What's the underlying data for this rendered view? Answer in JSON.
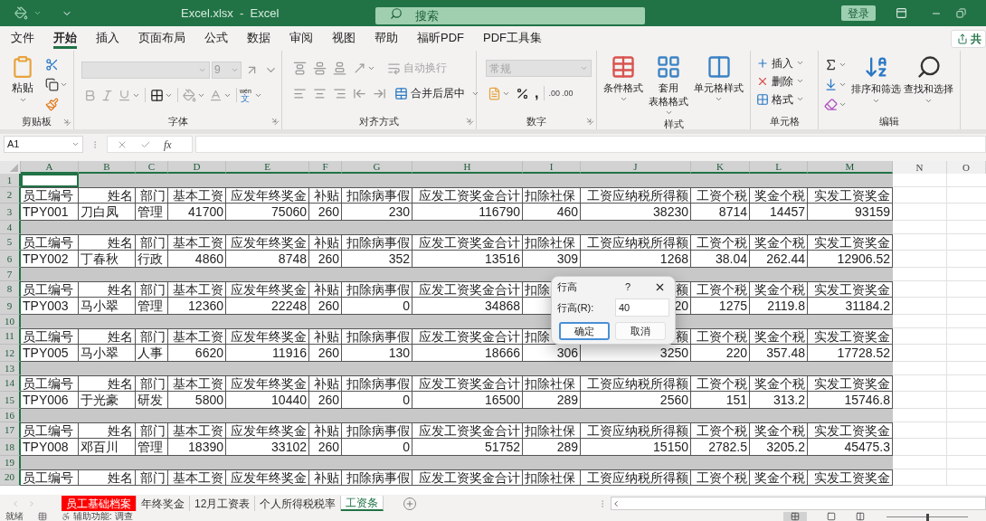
{
  "title_bar": {
    "title": "Excel.xlsx  -  Excel",
    "search": {
      "placeholder": "搜索"
    },
    "sign_in": "登录"
  },
  "menu_tabs": [
    {
      "label": "文件",
      "selected": false
    },
    {
      "label": "开始",
      "selected": true
    },
    {
      "label": "插入",
      "selected": false
    },
    {
      "label": "页面布局",
      "selected": false
    },
    {
      "label": "公式",
      "selected": false
    },
    {
      "label": "数据",
      "selected": false
    },
    {
      "label": "审阅",
      "selected": false
    },
    {
      "label": "视图",
      "selected": false
    },
    {
      "label": "帮助",
      "selected": false
    },
    {
      "label": "福昕PDF",
      "selected": false
    },
    {
      "label": "PDF工具集",
      "selected": false
    }
  ],
  "share": "共",
  "ribbon": {
    "clipboard": {
      "label": "剪贴板",
      "paste": "粘贴"
    },
    "font": {
      "label": "字体",
      "size": "9",
      "phonetic_top": "wén",
      "phonetic_bottom": "文"
    },
    "alignment": {
      "label": "对齐方式",
      "wrap": {
        "label": "自动换行",
        "disabled": true
      },
      "merge": "合并后居中"
    },
    "number": {
      "label": "数字",
      "format": {
        "value": "常规",
        "disabled": true
      },
      "comma": ",",
      "decimal_increase": ".00",
      "decimal_decrease": ".00"
    },
    "styles": {
      "label": "样式",
      "items": [
        {
          "lines": [
            "条件格式"
          ]
        },
        {
          "lines": [
            "套用",
            "表格格式"
          ]
        },
        {
          "lines": [
            "单元格样式"
          ]
        }
      ]
    },
    "cells": {
      "label": "单元格",
      "items": [
        "插入",
        "删除",
        "格式"
      ]
    },
    "editing": {
      "label": "编辑",
      "items": [
        "排序和筛选",
        "查找和选择"
      ]
    }
  },
  "formula_bar": {
    "name_box": "A1",
    "function_label": "fx"
  },
  "sheet": {
    "columns": [
      {
        "label": "A",
        "selected": true
      },
      {
        "label": "B",
        "selected": true
      },
      {
        "label": "C",
        "selected": true
      },
      {
        "label": "D",
        "selected": true
      },
      {
        "label": "E",
        "selected": true
      },
      {
        "label": "F",
        "selected": true
      },
      {
        "label": "G",
        "selected": true
      },
      {
        "label": "H",
        "selected": true
      },
      {
        "label": "I",
        "selected": true
      },
      {
        "label": "J",
        "selected": true
      },
      {
        "label": "K",
        "selected": true
      },
      {
        "label": "L",
        "selected": true
      },
      {
        "label": "M",
        "selected": true
      },
      {
        "label": "N",
        "selected": false
      },
      {
        "label": "O",
        "selected": false
      }
    ],
    "rows": [
      {
        "number": "1",
        "kind": "spacer",
        "active": true
      },
      {
        "number": "2",
        "kind": "header",
        "cells": [
          "员工编号",
          "姓名",
          "部门",
          "基本工资",
          "应发年终奖金",
          "补贴",
          "扣除病事假",
          "应发工资奖金合计",
          "扣除社保",
          "工资应纳税所得额",
          "工资个税",
          "奖金个税",
          "实发工资奖金"
        ]
      },
      {
        "number": "3",
        "kind": "data",
        "cells": [
          "TPY001",
          "刀白凤",
          "管理",
          "41700",
          "75060",
          "260",
          "230",
          "116790",
          "460",
          "38230",
          "8714",
          "14457",
          "93159"
        ]
      },
      {
        "number": "4",
        "kind": "spacer"
      },
      {
        "number": "5",
        "kind": "header",
        "cells": [
          "员工编号",
          "姓名",
          "部门",
          "基本工资",
          "应发年终奖金",
          "补贴",
          "扣除病事假",
          "应发工资奖金合计",
          "扣除社保",
          "工资应纳税所得额",
          "工资个税",
          "奖金个税",
          "实发工资奖金"
        ]
      },
      {
        "number": "6",
        "kind": "data",
        "cells": [
          "TPY002",
          "丁春秋",
          "行政",
          "4860",
          "8748",
          "260",
          "352",
          "13516",
          "309",
          "1268",
          "38.04",
          "262.44",
          "12906.52"
        ]
      },
      {
        "number": "7",
        "kind": "spacer"
      },
      {
        "number": "8",
        "kind": "header",
        "cells": [
          "员工编号",
          "姓名",
          "部门",
          "基本工资",
          "应发年终奖金",
          "补贴",
          "扣除病事假",
          "应发工资奖金合计",
          "扣除",
          "额",
          "工资个税",
          "奖金个税",
          "实发工资奖金"
        ]
      },
      {
        "number": "9",
        "kind": "data",
        "cells": [
          "TPY003",
          "马小翠",
          "管理",
          "12360",
          "22248",
          "260",
          "0",
          "34868",
          null,
          "20",
          "1275",
          "2119.8",
          "31184.2"
        ]
      },
      {
        "number": "10",
        "kind": "spacer"
      },
      {
        "number": "11",
        "kind": "header",
        "cells": [
          "员工编号",
          "姓名",
          "部门",
          "基本工资",
          "应发年终奖金",
          "补贴",
          "扣除病事假",
          "应发工资奖金合计",
          "扣除",
          "额",
          "工资个税",
          "奖金个税",
          "实发工资奖金"
        ]
      },
      {
        "number": "12",
        "kind": "data",
        "cells": [
          "TPY005",
          "马小翠",
          "人事",
          "6620",
          "11916",
          "260",
          "130",
          "18666",
          "306",
          "3250",
          "220",
          "357.48",
          "17728.52"
        ]
      },
      {
        "number": "13",
        "kind": "spacer"
      },
      {
        "number": "14",
        "kind": "header",
        "cells": [
          "员工编号",
          "姓名",
          "部门",
          "基本工资",
          "应发年终奖金",
          "补贴",
          "扣除病事假",
          "应发工资奖金合计",
          "扣除社保",
          "工资应纳税所得额",
          "工资个税",
          "奖金个税",
          "实发工资奖金"
        ]
      },
      {
        "number": "15",
        "kind": "data",
        "cells": [
          "TPY006",
          "于光豪",
          "研发",
          "5800",
          "10440",
          "260",
          "0",
          "16500",
          "289",
          "2560",
          "151",
          "313.2",
          "15746.8"
        ]
      },
      {
        "number": "16",
        "kind": "spacer"
      },
      {
        "number": "17",
        "kind": "header",
        "cells": [
          "员工编号",
          "姓名",
          "部门",
          "基本工资",
          "应发年终奖金",
          "补贴",
          "扣除病事假",
          "应发工资奖金合计",
          "扣除社保",
          "工资应纳税所得额",
          "工资个税",
          "奖金个税",
          "实发工资奖金"
        ]
      },
      {
        "number": "18",
        "kind": "data",
        "cells": [
          "TPY008",
          "邓百川",
          "管理",
          "18390",
          "33102",
          "260",
          "0",
          "51752",
          "289",
          "15150",
          "2782.5",
          "3205.2",
          "45475.3"
        ]
      },
      {
        "number": "19",
        "kind": "spacer"
      },
      {
        "number": "20",
        "kind": "header",
        "cells": [
          "员工编号",
          "姓名",
          "部门",
          "基本工资",
          "应发年终奖金",
          "补贴",
          "扣除病事假",
          "应发工资奖金合计",
          "扣除社保",
          "工资应纳税所得额",
          "工资个税",
          "奖金个税",
          "实发工资奖金"
        ]
      }
    ]
  },
  "dialog": {
    "title": "行高",
    "help": "?",
    "label": "行高(R):",
    "value": "40",
    "buttons": [
      {
        "label": "确定",
        "default": true
      },
      {
        "label": "取消",
        "default": false
      }
    ]
  },
  "sheet_tabs": [
    {
      "label": "员工基础档案",
      "selected": false,
      "color": "#ff0000"
    },
    {
      "label": "年终奖金",
      "selected": false
    },
    {
      "label": "12月工资表",
      "selected": false
    },
    {
      "label": "个人所得税税率",
      "selected": false
    },
    {
      "label": "工资条",
      "selected": true
    }
  ],
  "status_bar": {
    "ready": "就绪",
    "accessibility": "辅助功能: 调查",
    "zoom": {
      "level": 0.5
    }
  }
}
